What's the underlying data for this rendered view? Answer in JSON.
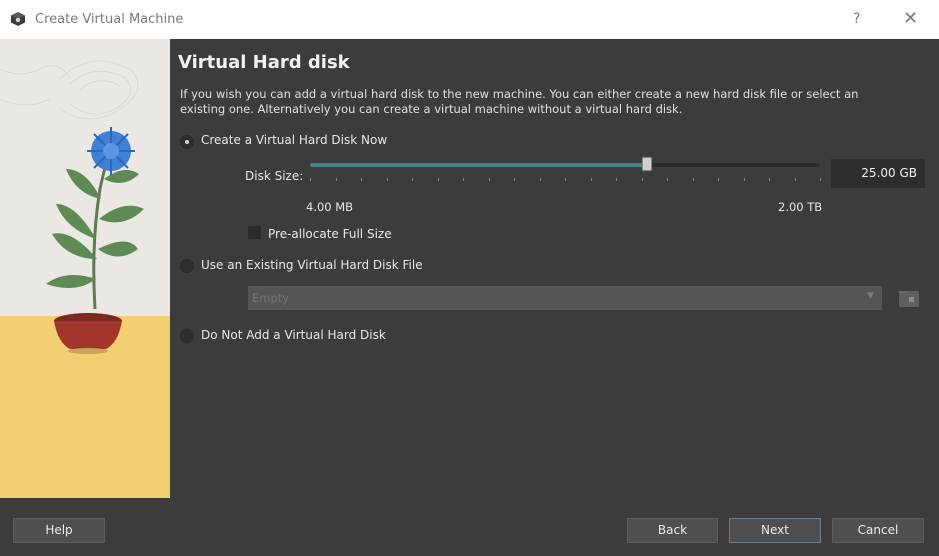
{
  "window": {
    "title": "Create Virtual Machine",
    "help_glyph": "?",
    "close_glyph": "✕"
  },
  "page": {
    "heading": "Virtual Hard disk",
    "description": "If you wish you can add a virtual hard disk to the new machine. You can either create a new hard disk file or select an existing one. Alternatively you can create a virtual machine without a virtual hard disk."
  },
  "options": {
    "create_now": {
      "label": "Create a Virtual Hard Disk Now",
      "checked": true
    },
    "use_existing": {
      "label": "Use an Existing Virtual Hard Disk File",
      "checked": false
    },
    "no_disk": {
      "label": "Do Not Add a Virtual Hard Disk",
      "checked": false
    }
  },
  "disk_size": {
    "label": "Disk Size:",
    "value": "25.00 GB",
    "min_label": "4.00 MB",
    "max_label": "2.00 TB",
    "slider_fraction": 0.66
  },
  "preallocate": {
    "label": "Pre-allocate Full Size",
    "checked": false
  },
  "existing_file": {
    "placeholder": "Empty"
  },
  "buttons": {
    "help": "Help",
    "back": "Back",
    "next": "Next",
    "cancel": "Cancel"
  },
  "colors": {
    "background": "#3c3c3c",
    "slider_fill": "#4a7f8c",
    "flower": "#3f7fd6",
    "pot": "#a3352a",
    "floor": "#f2cf72"
  },
  "icons": [
    "virtualbox-icon",
    "help-icon",
    "close-icon",
    "chevron-down-icon",
    "folder-icon"
  ]
}
